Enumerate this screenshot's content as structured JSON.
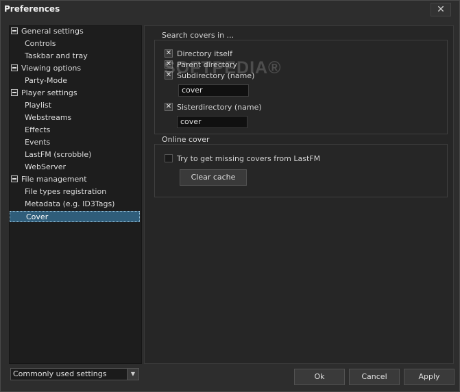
{
  "window": {
    "title": "Preferences",
    "close_glyph": "✕"
  },
  "tree": {
    "categories": [
      {
        "label": "General settings",
        "children": [
          "Controls",
          "Taskbar and tray"
        ]
      },
      {
        "label": "Viewing options",
        "children": [
          "Party-Mode"
        ]
      },
      {
        "label": "Player settings",
        "children": [
          "Playlist",
          "Webstreams",
          "Effects",
          "Events",
          "LastFM (scrobble)",
          "WebServer"
        ]
      },
      {
        "label": "File management",
        "children": [
          "File types registration",
          "Metadata (e.g. ID3Tags)",
          "Cover"
        ]
      }
    ],
    "selected": "Cover"
  },
  "search_covers": {
    "title": "Search covers in ...",
    "directory_itself": {
      "label": "Directory itself",
      "checked": true
    },
    "parent_directory": {
      "label": "Parent directory",
      "checked": true
    },
    "subdirectory": {
      "label": "Subdirectory (name)",
      "checked": true,
      "value": "cover"
    },
    "sisterdirectory": {
      "label": "Sisterdirectory (name)",
      "checked": true,
      "value": "cover"
    },
    "check_glyph": "✕"
  },
  "online_cover": {
    "title": "Online cover",
    "lastfm": {
      "label": "Try to get missing covers from LastFM",
      "checked": false
    },
    "clear_cache_label": "Clear cache"
  },
  "watermark": "SOFTPEDIA®",
  "footer": {
    "settings_filter": "Commonly used settings",
    "dropdown_glyph": "▼",
    "ok_label": "Ok",
    "cancel_label": "Cancel",
    "apply_label": "Apply"
  }
}
